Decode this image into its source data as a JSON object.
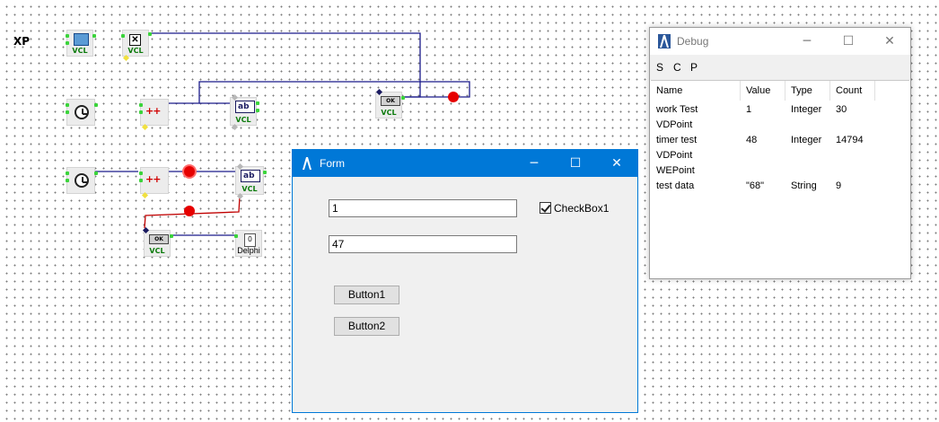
{
  "canvas": {
    "xp_label": "XP",
    "vcl_label": "VCL",
    "delphi_label": "Delphi",
    "ok_label": "OK",
    "edit_glyph": "ab",
    "plus_glyph": "++",
    "delphi_glyph": "0"
  },
  "form": {
    "title": "Form",
    "edit1_value": "1",
    "edit2_value": "47",
    "checkbox_label": "CheckBox1",
    "checkbox_checked": true,
    "button1_label": "Button1",
    "button2_label": "Button2"
  },
  "debug": {
    "title": "Debug",
    "menu": [
      "S",
      "C",
      "P"
    ],
    "columns": [
      "Name",
      "Value",
      "Type",
      "Count"
    ],
    "rows": [
      {
        "name": "work Test",
        "value": "1",
        "type": "Integer",
        "count": "30"
      },
      {
        "name": "VDPoint",
        "value": "",
        "type": "",
        "count": ""
      },
      {
        "name": "timer test",
        "value": "48",
        "type": "Integer",
        "count": "14794"
      },
      {
        "name": "VDPoint",
        "value": "",
        "type": "",
        "count": ""
      },
      {
        "name": "WEPoint",
        "value": "",
        "type": "",
        "count": ""
      },
      {
        "name": "test data",
        "value": "\"68\"",
        "type": "String",
        "count": "9"
      }
    ]
  },
  "colors": {
    "link_blue": "#1a1a8a",
    "link_red": "#c00000",
    "pin_green": "#3bd43b",
    "titlebar_active": "#0078d7",
    "vcl_green": "#0a7a0a"
  }
}
